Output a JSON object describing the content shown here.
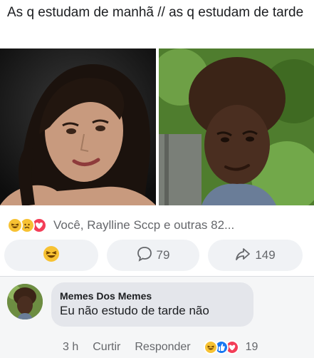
{
  "post": {
    "caption": "As q estudam de manhã // as q estudam de tarde",
    "reactions_text": "Você, Raylline Sccp e outras 82..."
  },
  "actions": {
    "comment_count": "79",
    "share_count": "149"
  },
  "comment": {
    "author": "Memes Dos Memes",
    "text": "Eu não estudo de tarde não",
    "time": "3 h",
    "like_label": "Curtir",
    "reply_label": "Responder",
    "reaction_count": "19"
  },
  "colors": {
    "haha": "#f7c233",
    "love": "#f33e58",
    "muted_text": "#65676b",
    "pill_bg": "#f0f2f5",
    "bubble_bg": "#e4e6eb"
  },
  "icons": [
    "haha-icon",
    "sad-icon",
    "love-icon",
    "comment-icon",
    "share-icon"
  ]
}
